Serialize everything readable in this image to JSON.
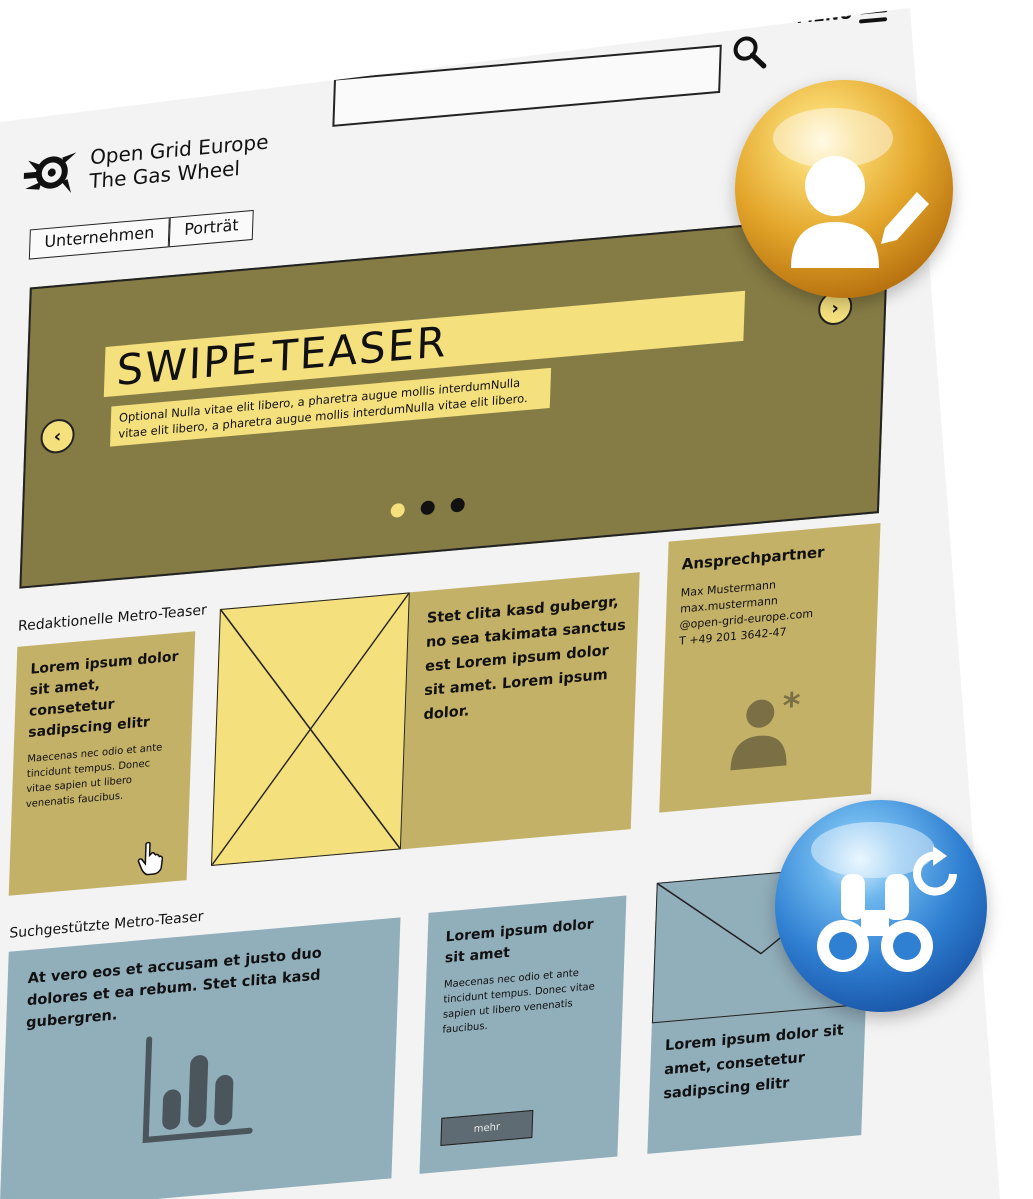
{
  "header": {
    "logo_line1": "Open Grid Europe",
    "logo_line2": "The Gas Wheel",
    "search_placeholder": "",
    "menu_label": "MENU"
  },
  "tabs": [
    {
      "label": "Unternehmen"
    },
    {
      "label": "Porträt"
    }
  ],
  "swipe_teaser": {
    "title": "SWIPE-TEASER",
    "subtitle": "Optional Nulla vitae elit libero, a pharetra augue mollis interdumNulla vitae elit libero, a pharetra augue mollis interdumNulla vitae elit libero.",
    "slide_count": 3,
    "active_slide": 1
  },
  "editorial_section": {
    "label": "Redaktionelle Metro-Teaser",
    "card1": {
      "heading": "Lorem ipsum dolor sit amet, consetetur sadipscing elitr",
      "body": "Maecenas nec odio et ante tincidunt tempus. Donec vitae sapien ut libero venenatis faucibus."
    },
    "card2": {
      "text": "Stet clita kasd gubergr, no sea takimata sanctus est Lorem ipsum dolor sit amet. Lorem ipsum dolor."
    },
    "contact": {
      "heading": "Ansprechpartner",
      "name": "Max Mustermann",
      "email_line1": "max.mustermann",
      "email_line2": "@open-grid-europe.com",
      "phone": "T +49 201 3642-47"
    }
  },
  "search_section": {
    "label": "Suchgestützte Metro-Teaser",
    "card4": {
      "text": "At vero eos et accusam et justo duo dolores et ea rebum. Stet clita kasd gubergren."
    },
    "card5": {
      "heading": "Lorem ipsum dolor sit amet",
      "body": "Maecenas nec odio et ante tincidunt tempus. Donec vitae sapien ut libero venenatis faucibus.",
      "button_label": "mehr"
    },
    "card6": {
      "text": "Lorem ipsum dolor sit amet, consetetur sadipscing elitr"
    }
  },
  "icons": {
    "search": "search-icon",
    "menu": "hamburger-icon",
    "logo": "gas-wheel-logo-icon",
    "prev": "chevron-left-icon",
    "next": "chevron-right-icon",
    "cursor": "hand-pointer-icon",
    "contact": "person-star-icon",
    "chart": "bar-chart-icon",
    "badge_top": "user-edit-icon",
    "badge_bottom": "binoculars-refresh-icon"
  },
  "colors": {
    "teaser_bg": "#857b45",
    "highlight_yellow": "#f5e07e",
    "card_yellow": "#c4b168",
    "card_blue": "#91aebb",
    "badge_gold": "#e3a52a",
    "badge_blue": "#2f7fd2"
  }
}
